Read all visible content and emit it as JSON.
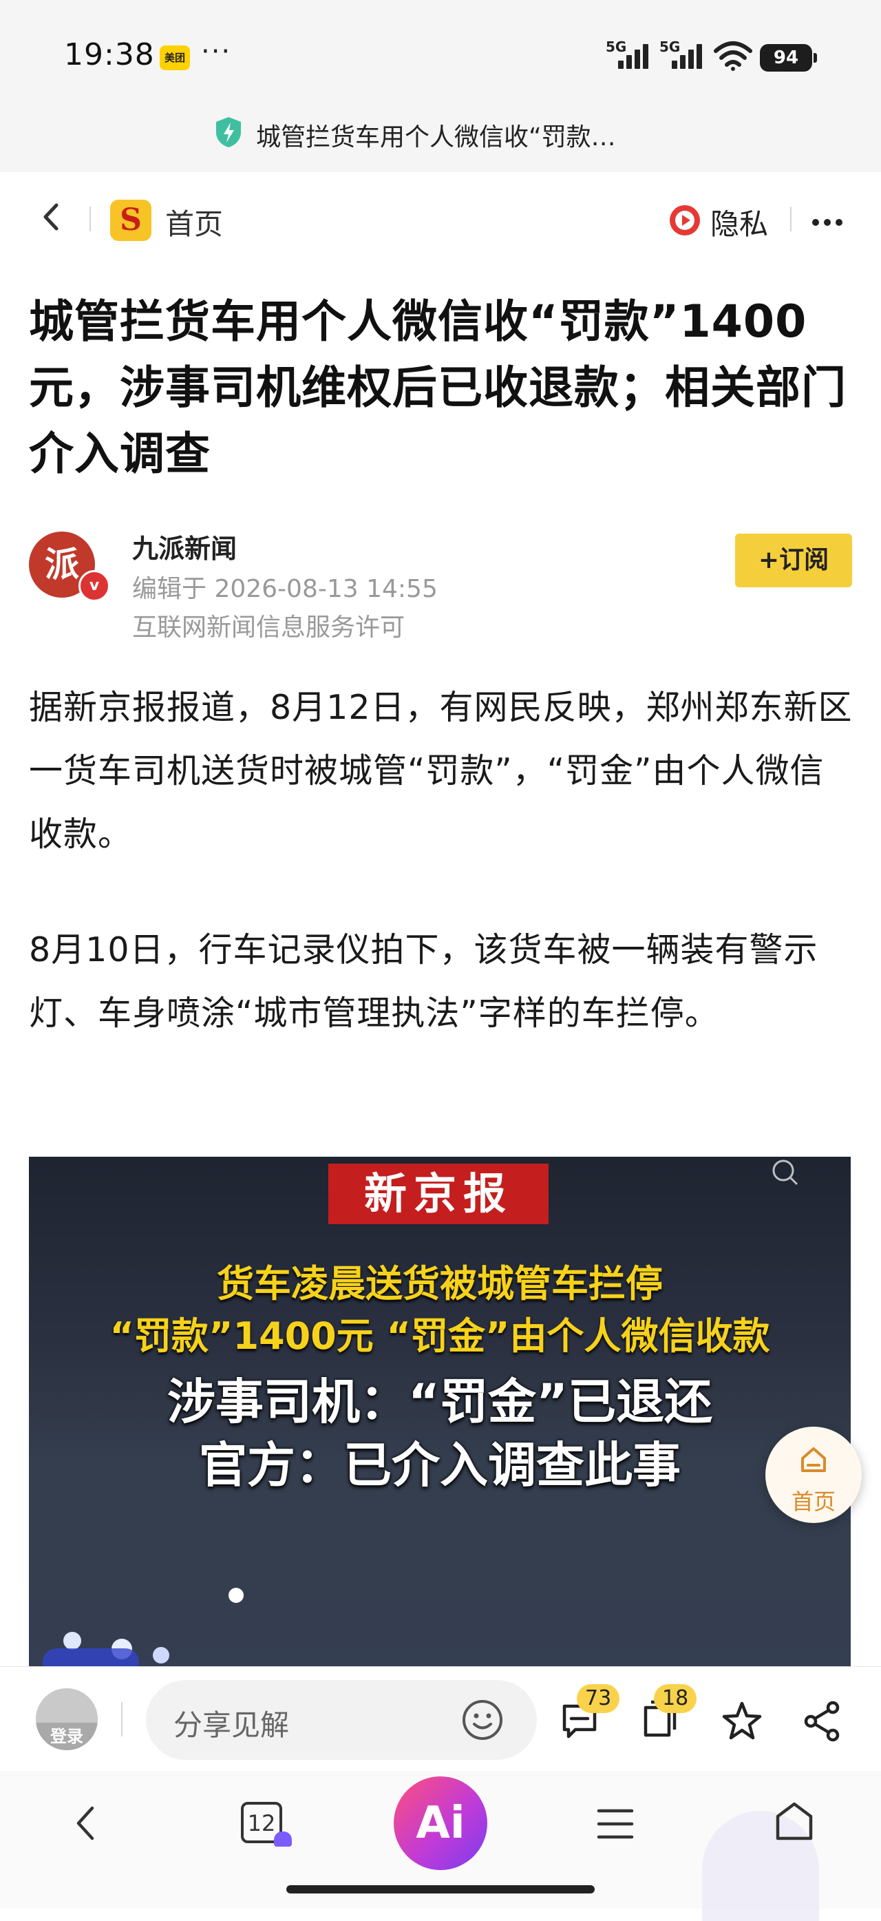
{
  "status_bar": {
    "time": "19:38",
    "app_badge": "美团",
    "dots": "···",
    "sim1": "5G",
    "sim2": "5G",
    "battery": "94"
  },
  "url_bar": {
    "title": "城管拦货车用个人微信收“罚款…",
    "icon": "shield-lightning-icon"
  },
  "header": {
    "logo_letter": "S",
    "home_label": "首页",
    "privacy_label": "隐私"
  },
  "article": {
    "title": "城管拦货车用个人微信收“罚款”1400元，涉事司机维权后已收退款；相关部门介入调查",
    "author": "九派新闻",
    "author_glyph": "派",
    "verified_mark": "v",
    "edit_time": "编辑于 2026-08-13 14:55",
    "license": "互联网新闻信息服务许可",
    "subscribe": "+订阅",
    "paragraphs": [
      "据新京报报道，8月12日，有网民反映，郑州郑东新区一货车司机送货时被城管“罚款”，“罚金”由个人微信收款。",
      "8月10日，行车记录仪拍下，该货车被一辆装有警示灯、车身喷涂“城市管理执法”字样的车拦停。"
    ]
  },
  "video": {
    "source": "新京报",
    "caption_line1": "货车凌晨送货被城管车拦停",
    "caption_line2": "“罚款”1400元  “罚金”由个人微信收款",
    "caption_line3": "涉事司机：“罚金”已退还",
    "caption_line4": "官方：已介入调查此事"
  },
  "float_home": {
    "label": "首页"
  },
  "comment_bar": {
    "login": "登录",
    "placeholder": "分享见解",
    "comment_count": "73",
    "favorite_count": "18"
  },
  "sys_nav": {
    "tabs_count": "12",
    "ai_label": "Ai"
  },
  "colors": {
    "accent_yellow": "#f5cf3b",
    "brand_red": "#c41e1e",
    "caption_yellow": "#f7d21a"
  }
}
